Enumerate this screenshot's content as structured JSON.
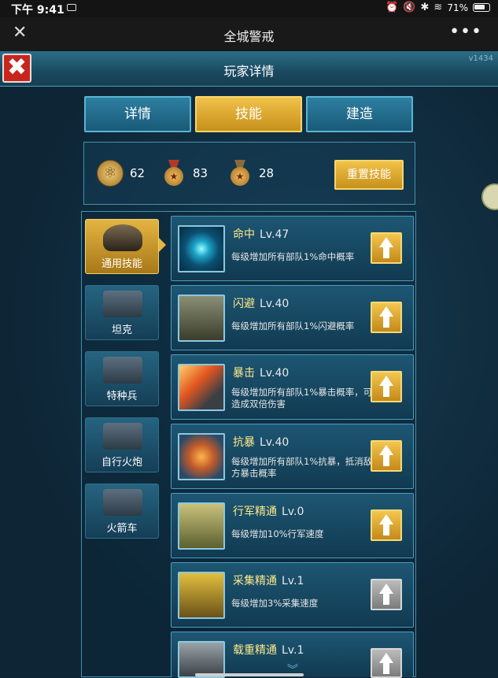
{
  "status": {
    "time": "下午 9:41",
    "battery": "71%"
  },
  "titlebar": {
    "title": "全城警戒",
    "close": "✕",
    "more": "•••"
  },
  "game": {
    "title": "玩家详情",
    "version": "v1434",
    "close": "✖"
  },
  "tabs": [
    {
      "label": "详情",
      "active": false
    },
    {
      "label": "技能",
      "active": true
    },
    {
      "label": "建造",
      "active": false
    }
  ],
  "resources": [
    {
      "icon": "atom-medal-icon",
      "value": "62"
    },
    {
      "icon": "red-star-medal-icon",
      "value": "83"
    },
    {
      "icon": "bronze-star-medal-icon",
      "value": "28"
    }
  ],
  "reset_label": "重置技能",
  "categories": [
    {
      "label": "通用技能",
      "active": true
    },
    {
      "label": "坦克",
      "active": false
    },
    {
      "label": "特种兵",
      "active": false
    },
    {
      "label": "自行火炮",
      "active": false
    },
    {
      "label": "火箭车",
      "active": false
    }
  ],
  "skills": [
    {
      "name": "命中",
      "level": "Lv.47",
      "desc": "每级增加所有部队1%命中概率",
      "icon": "target-icon",
      "upgradable": true
    },
    {
      "name": "闪避",
      "level": "Lv.40",
      "desc": "每级增加所有部队1%闪避概率",
      "icon": "tank-icon",
      "upgradable": true
    },
    {
      "name": "暴击",
      "level": "Lv.40",
      "desc": "每级增加所有部队1%暴击概率，可造成双倍伤害",
      "icon": "missile-icon",
      "upgradable": true
    },
    {
      "name": "抗暴",
      "level": "Lv.40",
      "desc": "每级增加所有部队1%抗暴，抵消敌方暴击概率",
      "icon": "shield-icon",
      "upgradable": true
    },
    {
      "name": "行军精通",
      "level": "Lv.0",
      "desc": "每级增加10%行军速度",
      "icon": "boot-icon",
      "upgradable": true
    },
    {
      "name": "采集精通",
      "level": "Lv.1",
      "desc": "每级增加3%采集速度",
      "icon": "bulldozer-icon",
      "upgradable": false
    },
    {
      "name": "载重精通",
      "level": "Lv.1",
      "desc": "",
      "icon": "truck-icon",
      "upgradable": false
    }
  ]
}
